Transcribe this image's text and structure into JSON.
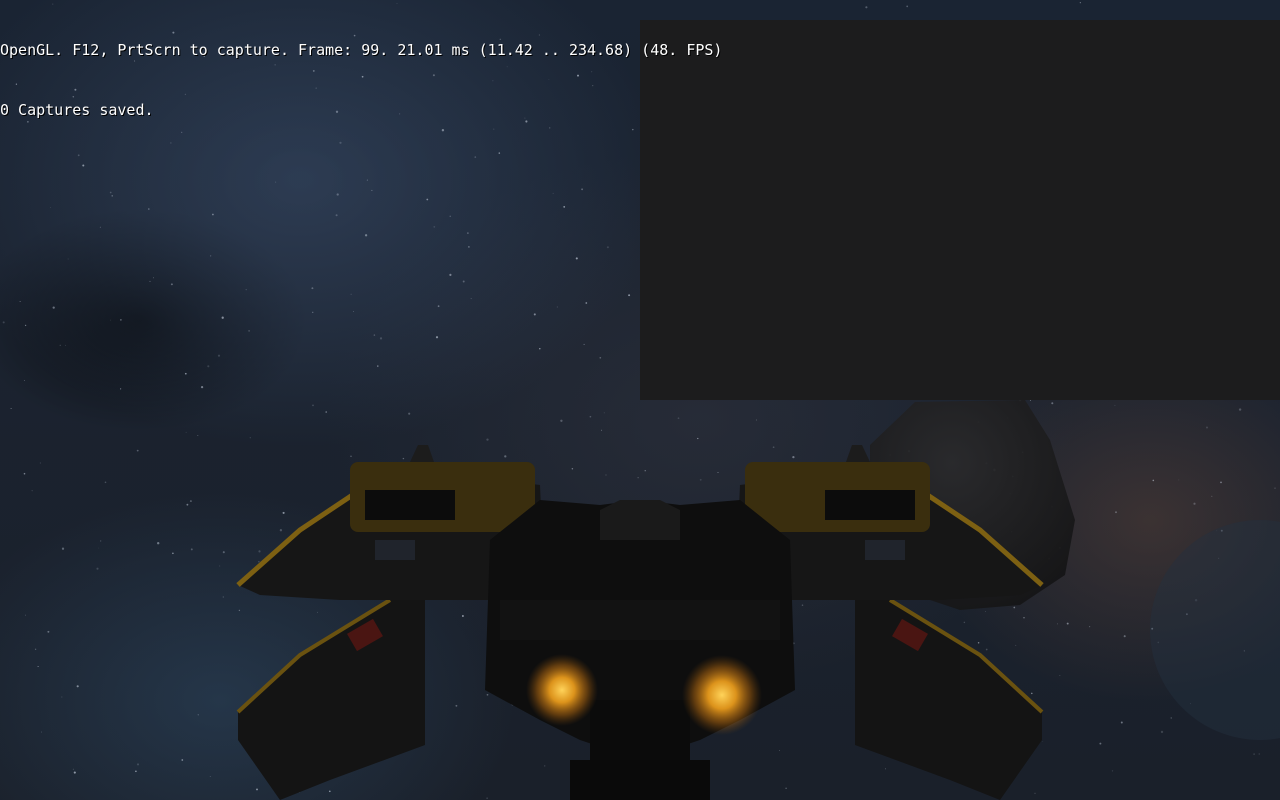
{
  "hud": {
    "status_line": "OpenGL. F12, PrtScrn to capture. Frame: 99. 21.01 ms (11.42 .. 234.68) (48. FPS)",
    "captures_line": "0 Captures saved."
  },
  "scene": {
    "ship_name": "spaceship",
    "engine_glow_color": "#f0a020",
    "hull_accent_color": "#8a6a12",
    "hull_base_color": "#0f0f10",
    "asteroid_color": "#1e1e20",
    "panel_color": "#1c1c1d"
  }
}
